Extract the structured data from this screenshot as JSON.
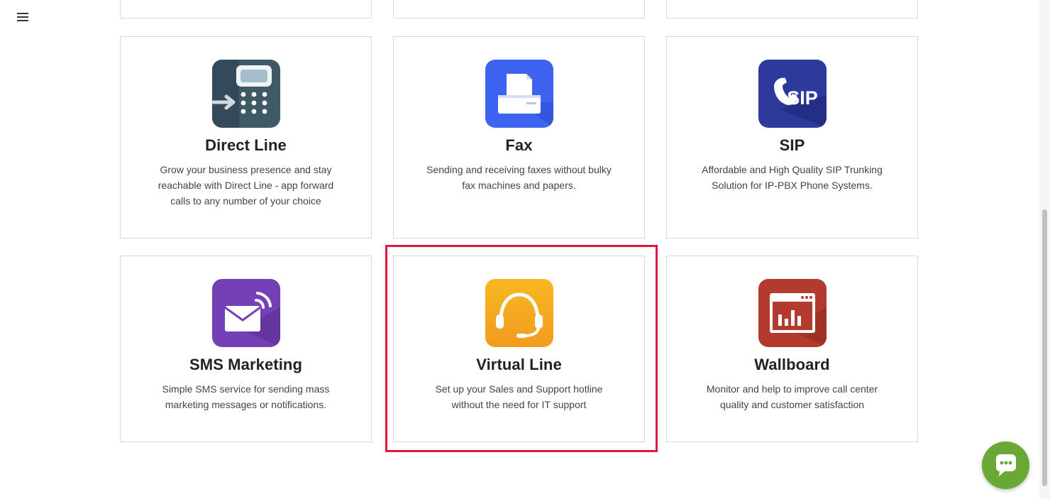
{
  "nav": {
    "menu_icon": "hamburger-menu-icon"
  },
  "cards": [
    {
      "title": "Direct Line",
      "description": "Grow your business presence and stay reachable with Direct Line - app forward calls to any number of your choice",
      "icon": "direct-line-keypad-icon",
      "color": "#3f5966"
    },
    {
      "title": "Fax",
      "description": "Sending and receiving faxes without bulky fax machines and papers.",
      "icon": "fax-machine-icon",
      "color": "#3d63f0"
    },
    {
      "title": "SIP",
      "description": "Affordable and High Quality SIP Trunking Solution for IP-PBX Phone Systems.",
      "icon": "sip-phone-icon",
      "icon_text": "SIP",
      "color": "#2d3a9c"
    },
    {
      "title": "SMS Marketing",
      "description": "Simple SMS service for sending mass marketing messages or notifications.",
      "icon": "sms-envelope-icon",
      "color": "#7540b5"
    },
    {
      "title": "Virtual Line",
      "description": "Set up your Sales and Support hotline without the need for IT support",
      "icon": "headset-icon",
      "color": "#f5a623"
    },
    {
      "title": "Wallboard",
      "description": "Monitor and help to improve call center quality and customer satisfaction",
      "icon": "wallboard-chart-icon",
      "color": "#b23a2e"
    }
  ],
  "chat": {
    "icon": "chat-bubble-icon",
    "color": "#6aa836"
  },
  "highlight_color": "#e0173f"
}
